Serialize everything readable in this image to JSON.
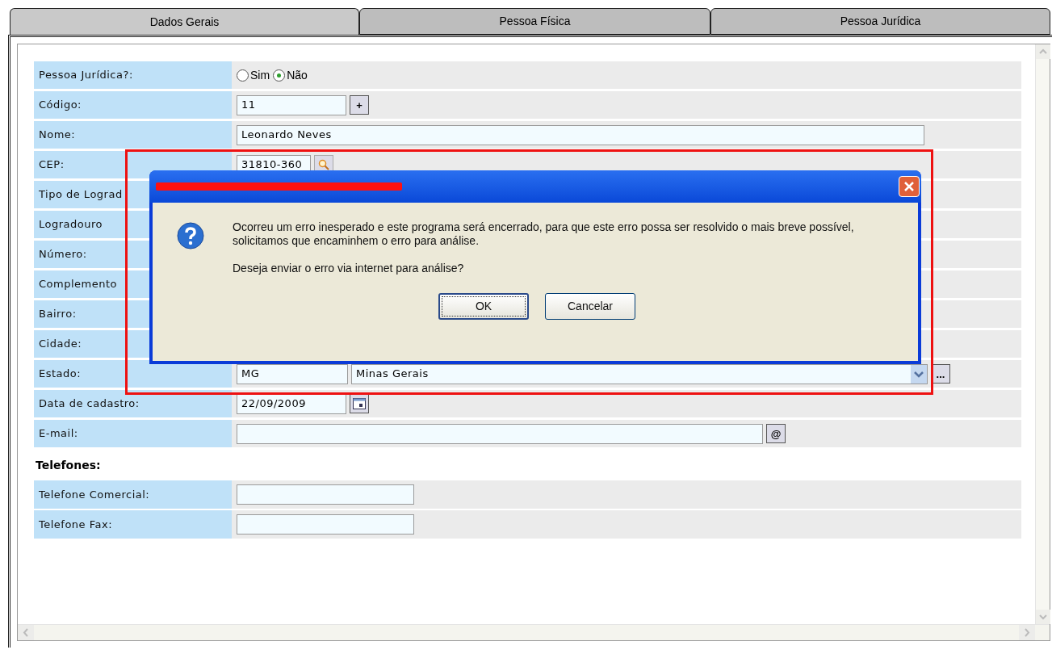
{
  "tabs": [
    {
      "label": "Dados Gerais",
      "selected": true
    },
    {
      "label": "Pessoa Física",
      "selected": false
    },
    {
      "label": "Pessoa Jurídica",
      "selected": false
    }
  ],
  "form": {
    "rows": [
      {
        "label": "Pessoa Jurídica?:",
        "kind": "radio",
        "options": [
          {
            "label": "Sim",
            "selected": false
          },
          {
            "label": "Não",
            "selected": true
          }
        ]
      },
      {
        "label": "Código:",
        "kind": "code",
        "value": "11",
        "button": "+"
      },
      {
        "label": "Nome:",
        "kind": "text",
        "value": "Leonardo Neves"
      },
      {
        "label": "CEP:",
        "kind": "lookup",
        "value": "31810-360"
      },
      {
        "label": "Tipo de Lograd",
        "kind": "covered"
      },
      {
        "label": "Logradouro",
        "kind": "covered"
      },
      {
        "label": "Número:",
        "kind": "covered"
      },
      {
        "label": "Complemento",
        "kind": "covered"
      },
      {
        "label": "Bairro:",
        "kind": "covered"
      },
      {
        "label": "Cidade:",
        "kind": "covered"
      },
      {
        "label": "Estado:",
        "kind": "state",
        "code": "MG",
        "value": "Minas Gerais",
        "button": "..."
      },
      {
        "label": "Data de cadastro:",
        "kind": "date",
        "value": "22/09/2009"
      },
      {
        "label": "E-mail:",
        "kind": "email",
        "button": "@"
      }
    ],
    "section_heading": "Telefones:",
    "phone_rows": [
      {
        "label": "Telefone Comercial:"
      },
      {
        "label": "Telefone Fax:"
      }
    ]
  },
  "dialog": {
    "message": "Ocorreu um erro inesperado e este programa será encerrado, para que este erro possa ser resolvido o mais breve possível, solicitamos que encaminhem o erro para análise.",
    "question": "Deseja enviar o erro via internet para análise?",
    "buttons": [
      {
        "label": "OK",
        "default": true
      },
      {
        "label": "Cancelar",
        "default": false
      }
    ]
  }
}
